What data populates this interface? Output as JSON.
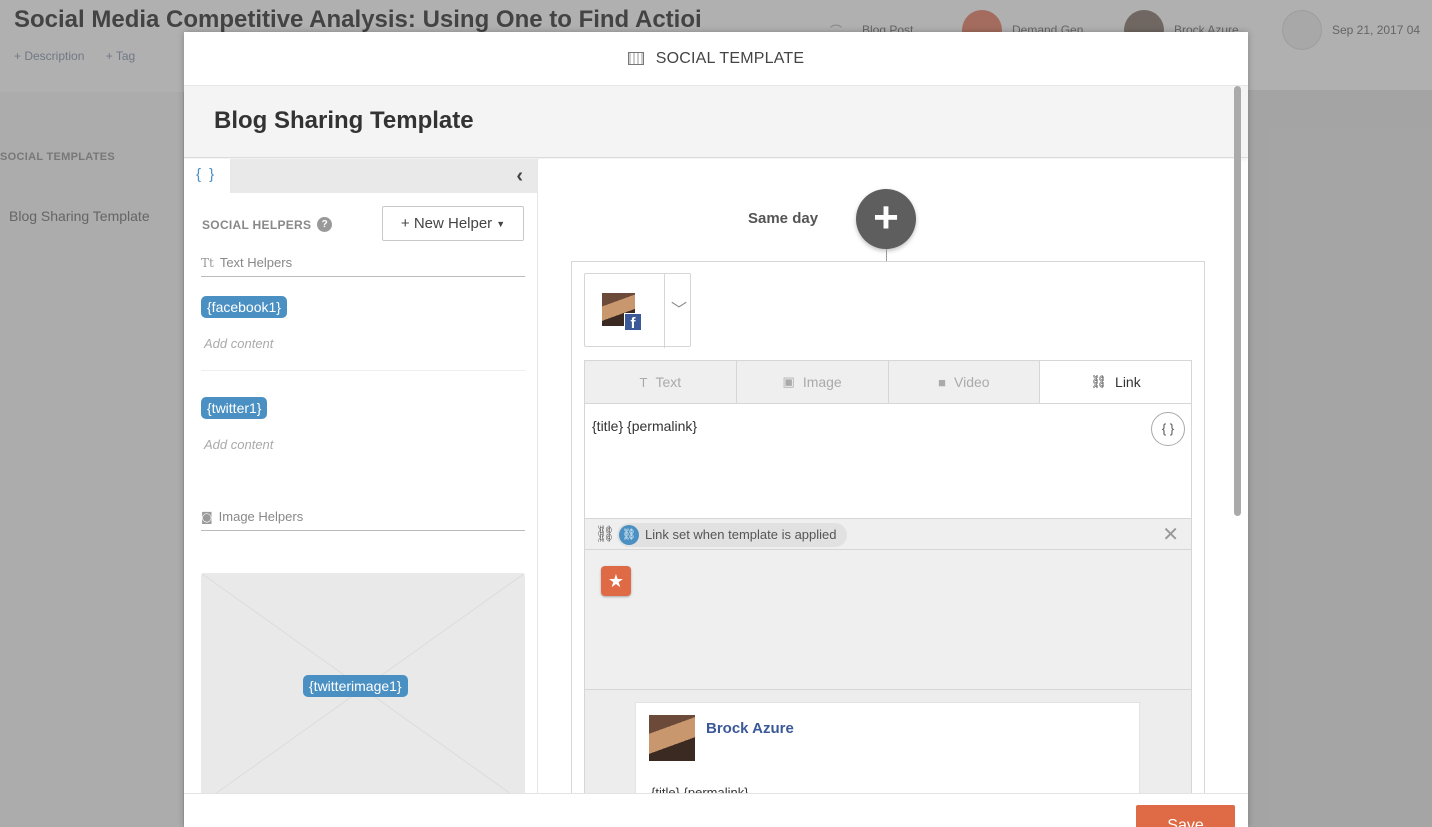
{
  "background": {
    "title": "Social Media Competitive Analysis: Using One to Find Actioi",
    "description_link": "+ Description",
    "tag_link": "+ Tag",
    "meta": {
      "type": "Blog Post",
      "campaign": "Demand Gen",
      "author": "Brock Azure",
      "date": "Sep 21, 2017 04"
    },
    "sidebar": {
      "braces": "{ }",
      "section_label": "SOCIAL TEMPLATES",
      "item": "Blog Sharing Template"
    }
  },
  "modal": {
    "header": "SOCIAL TEMPLATE",
    "title": "Blog Sharing Template",
    "left_panel": {
      "tab_label": "{ }",
      "collapse_icon": "chevron-left-icon",
      "helpers_label": "SOCIAL HELPERS",
      "help_icon": "?",
      "new_helper_button": "+ New Helper",
      "text_helpers": {
        "label": "Text Helpers",
        "icon": "Tt",
        "items": [
          {
            "tag": "{facebook1}",
            "placeholder": "Add content"
          },
          {
            "tag": "{twitter1}",
            "placeholder": "Add content"
          }
        ]
      },
      "image_helpers": {
        "label": "Image Helpers",
        "icon": "camera-icon",
        "items": [
          {
            "tag": "{twitterimage1}"
          }
        ]
      }
    },
    "composer": {
      "schedule_label": "Same day",
      "add_icon": "+",
      "account": {
        "network": "facebook",
        "name": "Brock Azure"
      },
      "tabs": [
        {
          "label": "Text",
          "icon": "T",
          "active": false
        },
        {
          "label": "Image",
          "icon": "▣",
          "active": false
        },
        {
          "label": "Video",
          "icon": "■",
          "active": false
        },
        {
          "label": "Link",
          "icon": "🔗",
          "active": true
        }
      ],
      "message": "{title} {permalink}",
      "variables_button": "{ }",
      "link_status": "Link set when template is applied",
      "preview": {
        "name": "Brock Azure",
        "text": "{title} {permalink}"
      }
    },
    "footer": {
      "save_button": "Save"
    }
  },
  "colors": {
    "accent_blue": "#4a90c2",
    "save_orange": "#de6b45",
    "facebook_blue": "#3b5998"
  }
}
